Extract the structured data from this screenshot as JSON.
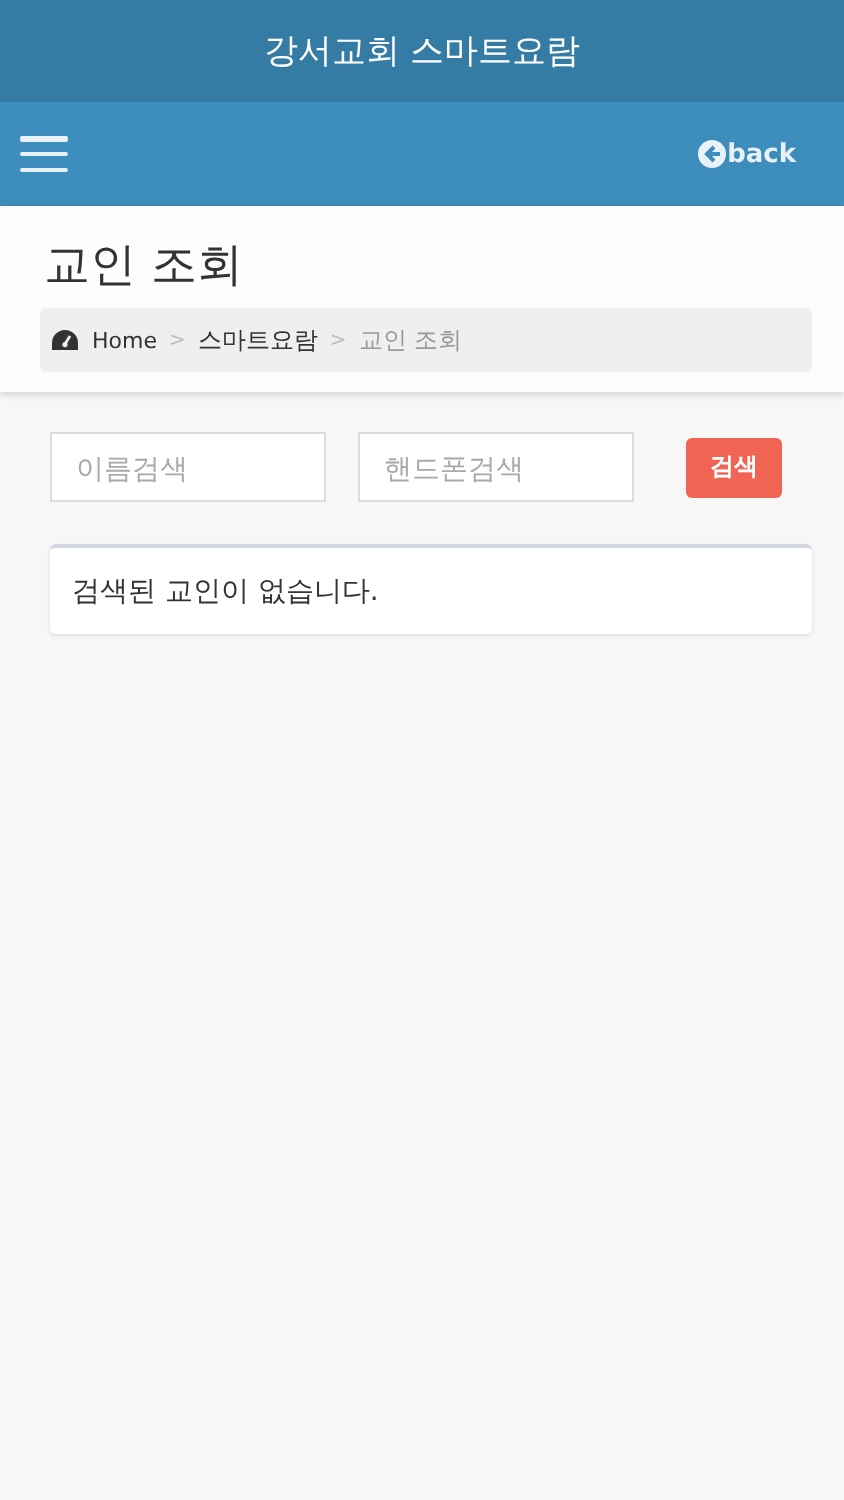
{
  "app_title": "강서교회 스마트요람",
  "nav": {
    "back": "back"
  },
  "page_title": "교인 조회",
  "breadcrumb": [
    {
      "label": "Home",
      "kind": "home"
    },
    {
      "separator": ">",
      "label": "스마트요람",
      "kind": "link"
    },
    {
      "separator": ">",
      "label": "교인 조회",
      "kind": "current"
    }
  ],
  "search": {
    "name_placeholder": "이름검색",
    "phone_placeholder": "핸드폰검색",
    "button": "검색"
  },
  "result": "검색된 교인이 없습니다."
}
